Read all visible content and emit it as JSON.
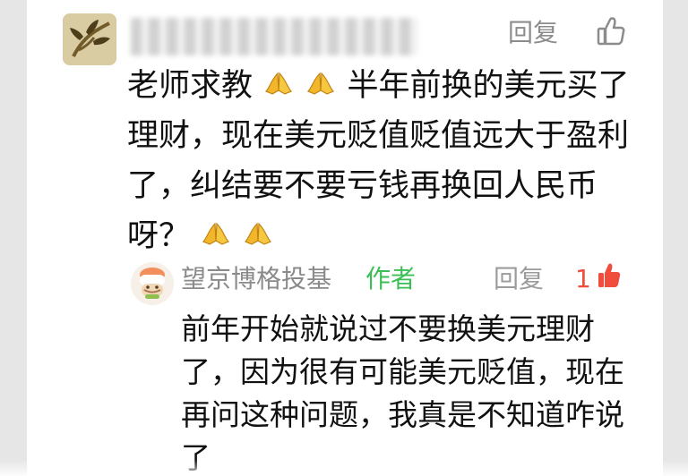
{
  "top_comment": {
    "username": "",
    "reply_label": "回复",
    "text_before": "老师求教",
    "text_middle": "半年前换的美元买了理财，现在美元贬值贬值远大于盈利了，纠结要不要亏钱再换回人民币呀？",
    "like_icon": "thumbs-up-outline-icon",
    "emoji_icon": "pray-hands-emoji"
  },
  "reply": {
    "name": "望京博格投基",
    "author_tag": "作者",
    "reply_label": "回复",
    "like_count": "1",
    "text": "前年开始就说过不要换美元理财了，因为很有可能美元贬值，现在再问这种问题，我真是不知道咋说了",
    "like_icon": "thumbs-up-filled-red-icon"
  },
  "colors": {
    "background": "#ffffff",
    "muted_text": "#9b9b9b",
    "author_green": "#3bbf55",
    "like_red": "#f04d3c",
    "body_text": "#111111",
    "side_panel": "#e6e6e6"
  }
}
